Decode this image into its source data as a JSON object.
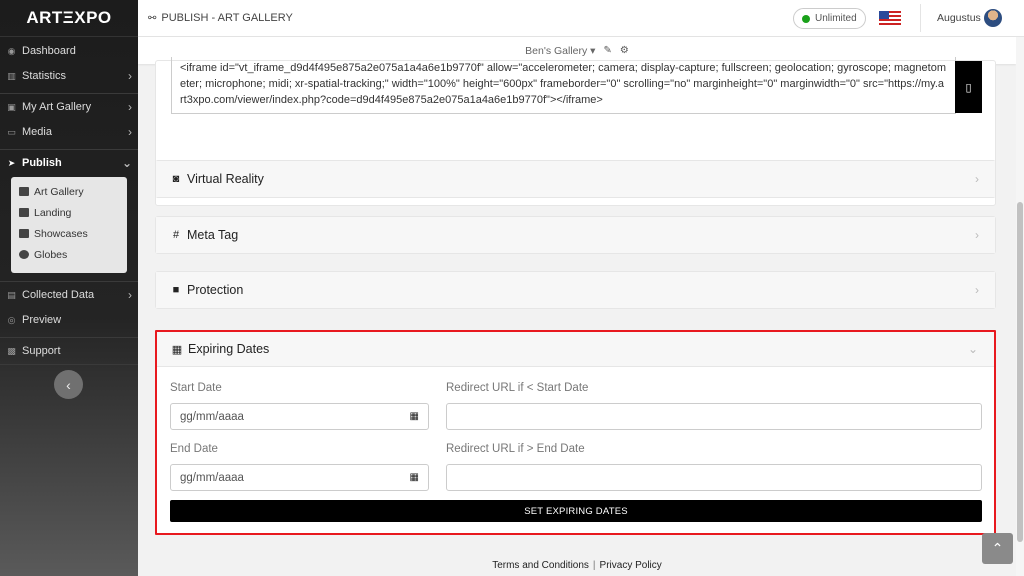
{
  "sidebar": {
    "logo": "ARTΞXPO",
    "items": [
      {
        "label": "Dashboard",
        "icon": "dashboard-icon"
      },
      {
        "label": "Statistics",
        "icon": "chart-icon"
      },
      {
        "label": "My Art Gallery",
        "icon": "gallery-icon"
      },
      {
        "label": "Media",
        "icon": "monitor-icon"
      },
      {
        "label": "Publish",
        "icon": "send-icon"
      }
    ],
    "submenu": [
      {
        "label": "Art Gallery",
        "icon": "sitemap-icon"
      },
      {
        "label": "Landing",
        "icon": "file-icon"
      },
      {
        "label": "Showcases",
        "icon": "image-icon"
      },
      {
        "label": "Globes",
        "icon": "globe-icon"
      }
    ],
    "items_after": [
      {
        "label": "Collected Data",
        "icon": "folder-icon"
      },
      {
        "label": "Preview",
        "icon": "eye-icon"
      },
      {
        "label": "Support",
        "icon": "support-icon"
      }
    ],
    "collapse_glyph": "‹"
  },
  "topbar": {
    "title": "PUBLISH - ART GALLERY",
    "plan": "Unlimited",
    "plan_color": "#1aa11a",
    "user": "Augustus"
  },
  "subbar": {
    "gallery": "Ben's Gallery ▾"
  },
  "embed": {
    "code": "<iframe id=\"vt_iframe_d9d4f495e875a2e075a1a4a6e1b9770f\" allow=\"accelerometer; camera; display-capture; fullscreen; geolocation; gyroscope; magnetometer; microphone; midi; xr-spatial-tracking;\" width=\"100%\" height=\"600px\" frameborder=\"0\" scrolling=\"no\" marginheight=\"0\" marginwidth=\"0\" src=\"https://my.art3xpo.com/viewer/index.php?code=d9d4f495e875a2e075a1a4a6e1b9770f\"></iframe>"
  },
  "sections": {
    "vr": "Virtual Reality",
    "meta": "Meta Tag",
    "protection": "Protection",
    "expiring": "Expiring Dates"
  },
  "expiring": {
    "start_label": "Start Date",
    "start_value": "gg/mm/aaaa",
    "redirect_start_label": "Redirect URL if < Start Date",
    "end_label": "End Date",
    "end_value": "gg/mm/aaaa",
    "redirect_end_label": "Redirect URL if > End Date",
    "button": "SET EXPIRING DATES"
  },
  "footer": {
    "terms": "Terms and Conditions",
    "privacy": "Privacy Policy"
  }
}
